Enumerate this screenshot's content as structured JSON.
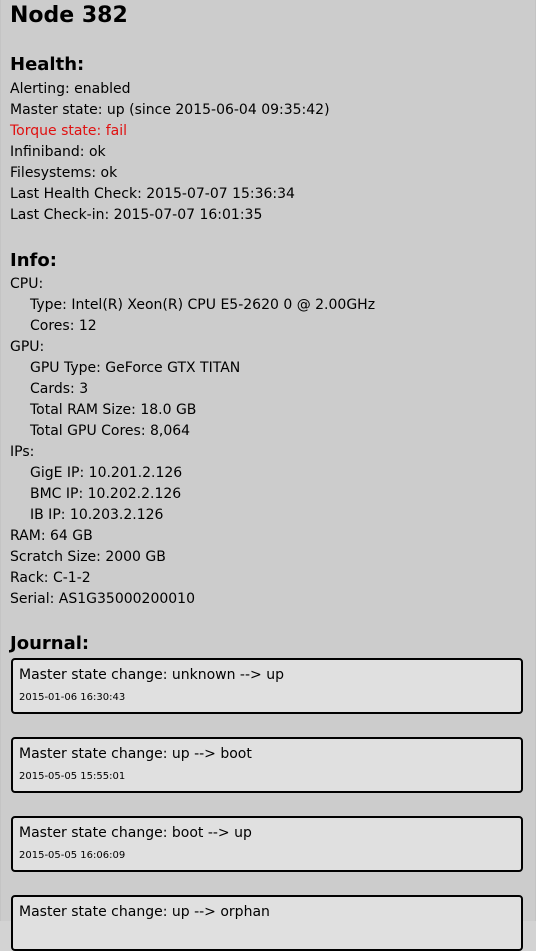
{
  "node_title": "Node 382",
  "health": {
    "heading": "Health:",
    "alerting": "Alerting: enabled",
    "master_state": "Master state: up (since 2015-06-04 09:35:42)",
    "torque_state": "Torque state: fail",
    "infiniband": "Infiniband: ok",
    "filesystems": "Filesystems: ok",
    "last_health_check": "Last Health Check: 2015-07-07 15:36:34",
    "last_check_in": "Last Check-in: 2015-07-07 16:01:35",
    "fail_color": "#e01010"
  },
  "info": {
    "heading": "Info:",
    "cpu_label": "CPU:",
    "cpu_type": "Type: Intel(R) Xeon(R) CPU E5-2620 0 @ 2.00GHz",
    "cpu_cores": "Cores: 12",
    "gpu_label": "GPU:",
    "gpu_type": "GPU Type: GeForce GTX TITAN",
    "gpu_cards": "Cards: 3",
    "gpu_ram": "Total RAM Size: 18.0 GB",
    "gpu_cores": "Total GPU Cores: 8,064",
    "ips_label": "IPs:",
    "gige_ip": "GigE IP: 10.201.2.126",
    "bmc_ip": "BMC IP: 10.202.2.126",
    "ib_ip": "IB IP: 10.203.2.126",
    "ram": "RAM: 64 GB",
    "scratch": "Scratch Size: 2000 GB",
    "rack": "Rack: C-1-2",
    "serial": "Serial: AS1G35000200010"
  },
  "journal": {
    "heading": "Journal:",
    "entries": [
      {
        "text": "Master state change: unknown --> up",
        "time": "2015-01-06 16:30:43"
      },
      {
        "text": "Master state change: up --> boot",
        "time": "2015-05-05 15:55:01"
      },
      {
        "text": "Master state change: boot --> up",
        "time": "2015-05-05 16:06:09"
      },
      {
        "text": "Master state change: up --> orphan",
        "time": ""
      }
    ]
  }
}
